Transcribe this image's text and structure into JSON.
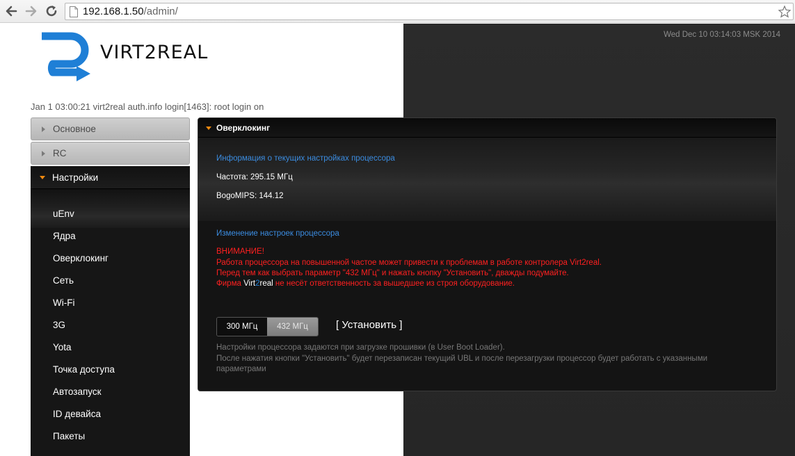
{
  "browser": {
    "url_host": "192.168.1.50",
    "url_path": "/admin/"
  },
  "header": {
    "datetime": "Wed Dec 10 03:14:03 MSK 2014",
    "logo_text": "VIRT2REAL",
    "log_line": "Jan 1 03:00:21 virt2real auth.info login[1463]: root login on"
  },
  "sidebar": {
    "sections": [
      {
        "label": "Основное"
      },
      {
        "label": "RC"
      },
      {
        "label": "Настройки"
      }
    ],
    "items": [
      {
        "label": "uEnv"
      },
      {
        "label": "Ядра"
      },
      {
        "label": "Оверклокинг"
      },
      {
        "label": "Сеть"
      },
      {
        "label": "Wi-Fi"
      },
      {
        "label": "3G"
      },
      {
        "label": "Yota"
      },
      {
        "label": "Точка доступа"
      },
      {
        "label": "Автозапуск"
      },
      {
        "label": "ID девайса"
      },
      {
        "label": "Пакеты"
      }
    ]
  },
  "panel": {
    "title": "Оверклокинг",
    "info_heading": "Информация о текущих настройках процессора",
    "frequency": "Частота: 295.15 МГц",
    "bogomips": "BogoMIPS: 144.12",
    "change_heading": "Изменение настроек процессора",
    "warning": {
      "title": "ВНИМАНИЕ!",
      "line1": "Работа процессора на повышенной частое может привести к проблемам в работе контролера Virt2real.",
      "line2": "Перед тем как выбрать параметр \"432 МГц\" и нажать кнопку \"Установить\", дважды подумайте.",
      "line3_prefix": "Фирма",
      "brand_a": "Virt",
      "brand_b": "2",
      "brand_c": "real",
      "line3_suffix": "не несёт ответственность за вышедшее из строя оборудование."
    },
    "freq_options": [
      {
        "label": "300 МГц",
        "selected": true
      },
      {
        "label": "432 МГц",
        "selected": false
      }
    ],
    "install_label": "[ Установить ]",
    "note_line1": "Настройки процессора задаются при загрузке прошивки (в User Boot Loader).",
    "note_line2": "После нажатия кнопки \"Установить\" будет перезаписан текущий UBL и после перезагрузки процессор будет работать с указанными",
    "note_line3": "параметрами"
  },
  "colors": {
    "accent_orange": "#f08a10",
    "link_blue": "#3b8ce0",
    "warning_red": "#ff2020",
    "logo_blue": "#1f7fd6"
  }
}
